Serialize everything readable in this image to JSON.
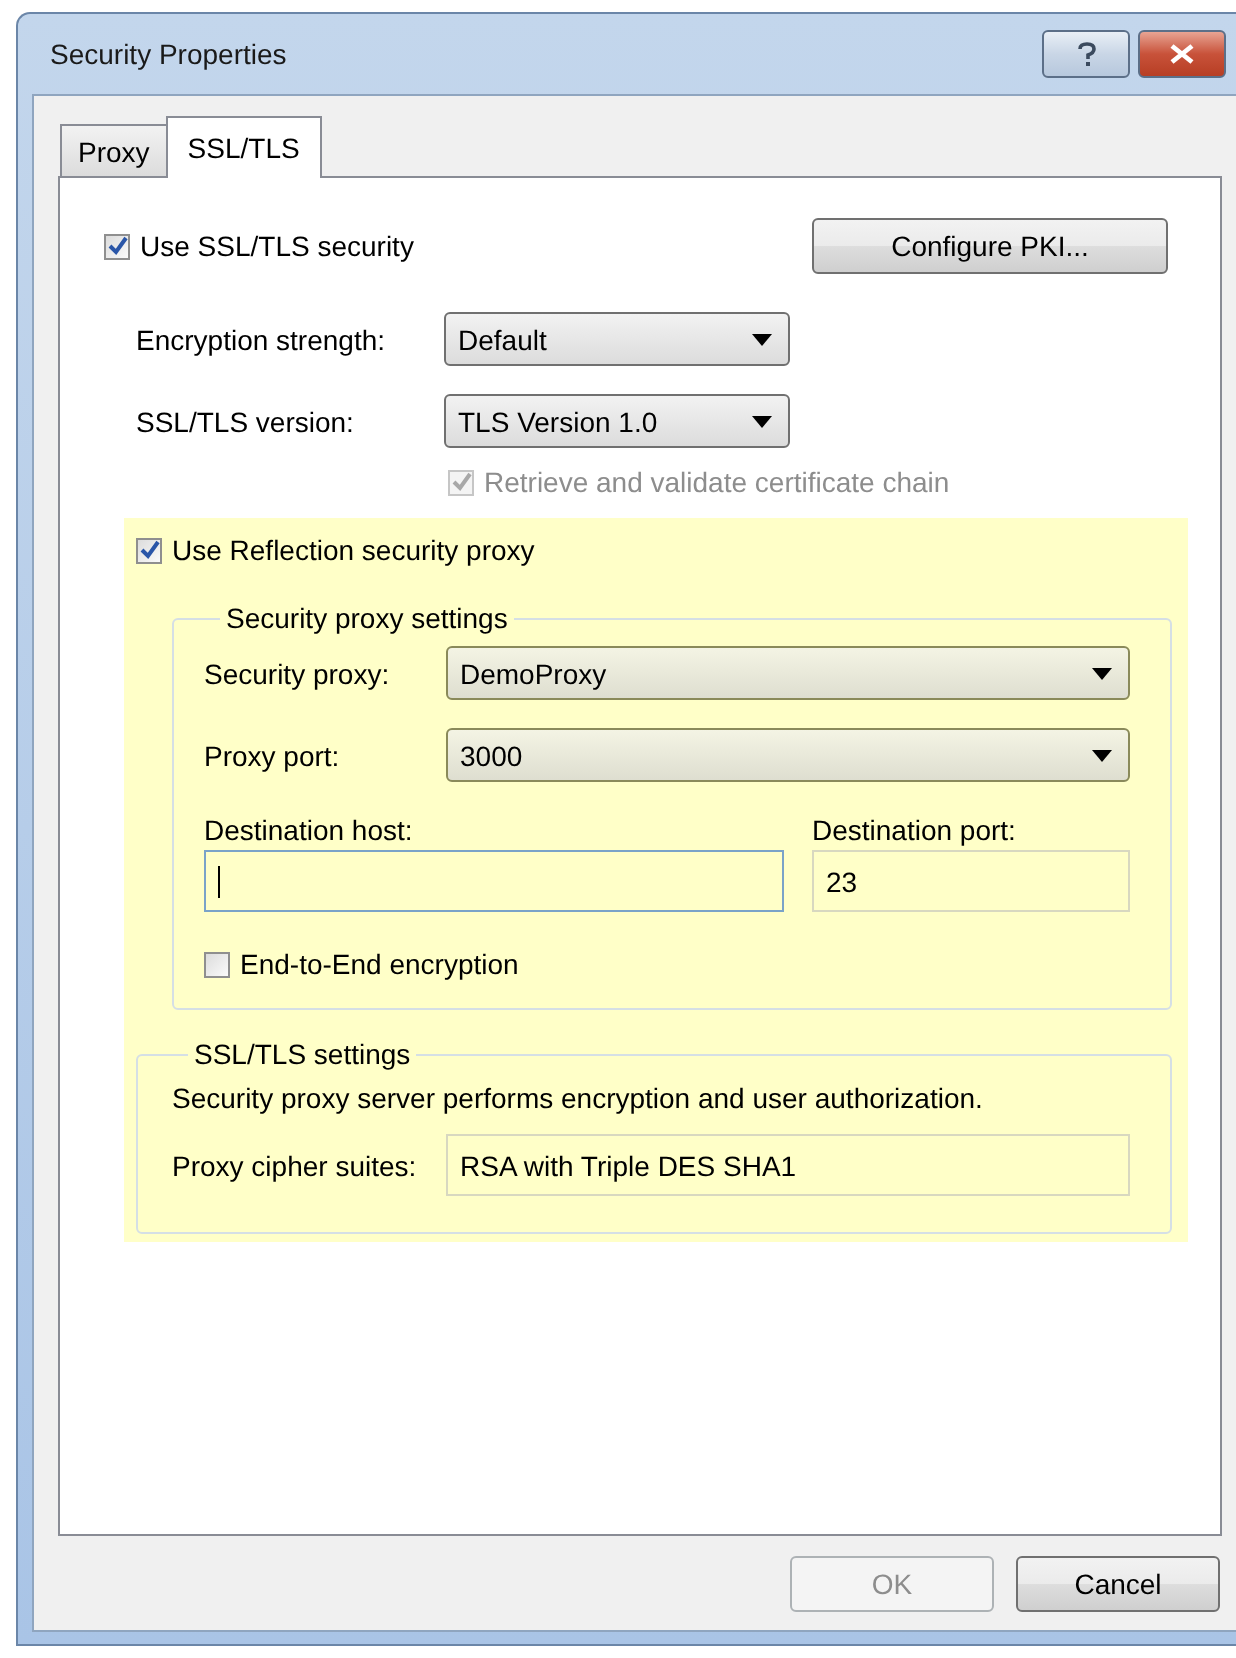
{
  "window": {
    "title": "Security Properties"
  },
  "tabs": [
    {
      "label": "Proxy",
      "selected": false
    },
    {
      "label": "SSL/TLS",
      "selected": true
    }
  ],
  "use_ssl": {
    "label": "Use SSL/TLS security",
    "checked": true,
    "disabled": false
  },
  "configure_button": {
    "label": "Configure PKI...",
    "disabled": false
  },
  "encryption_strength": {
    "label": "Encryption strength:",
    "value": "Default"
  },
  "ssl_version": {
    "label": "SSL/TLS version:",
    "value": "TLS Version 1.0"
  },
  "retrieve_chain": {
    "label": "Retrieve and validate certificate chain",
    "checked": true,
    "disabled": true
  },
  "proxy_section": {
    "highlighted": true,
    "use_proxy": {
      "label": "Use Reflection security proxy",
      "checked": true,
      "disabled": false
    },
    "settings_group": {
      "title": "Security proxy settings",
      "security_proxy": {
        "label": "Security proxy:",
        "value": "DemoProxy"
      },
      "proxy_port": {
        "label": "Proxy port:",
        "value": "3000"
      },
      "destination_host": {
        "label": "Destination host:",
        "focused": true
      },
      "destination_port": {
        "label": "Destination port:",
        "value": "23",
        "focused": false
      },
      "end_to_end": {
        "label": "End-to-End encryption",
        "checked": false,
        "disabled": false
      }
    },
    "ssl_group": {
      "title": "SSL/TLS settings",
      "description": "Security proxy server performs encryption and user authorization.",
      "cipher_label": "Proxy cipher suites:",
      "cipher_value": "RSA with Triple DES SHA1"
    }
  },
  "buttons": [
    {
      "label": "OK",
      "disabled": true
    },
    {
      "label": "Cancel",
      "disabled": false
    }
  ]
}
